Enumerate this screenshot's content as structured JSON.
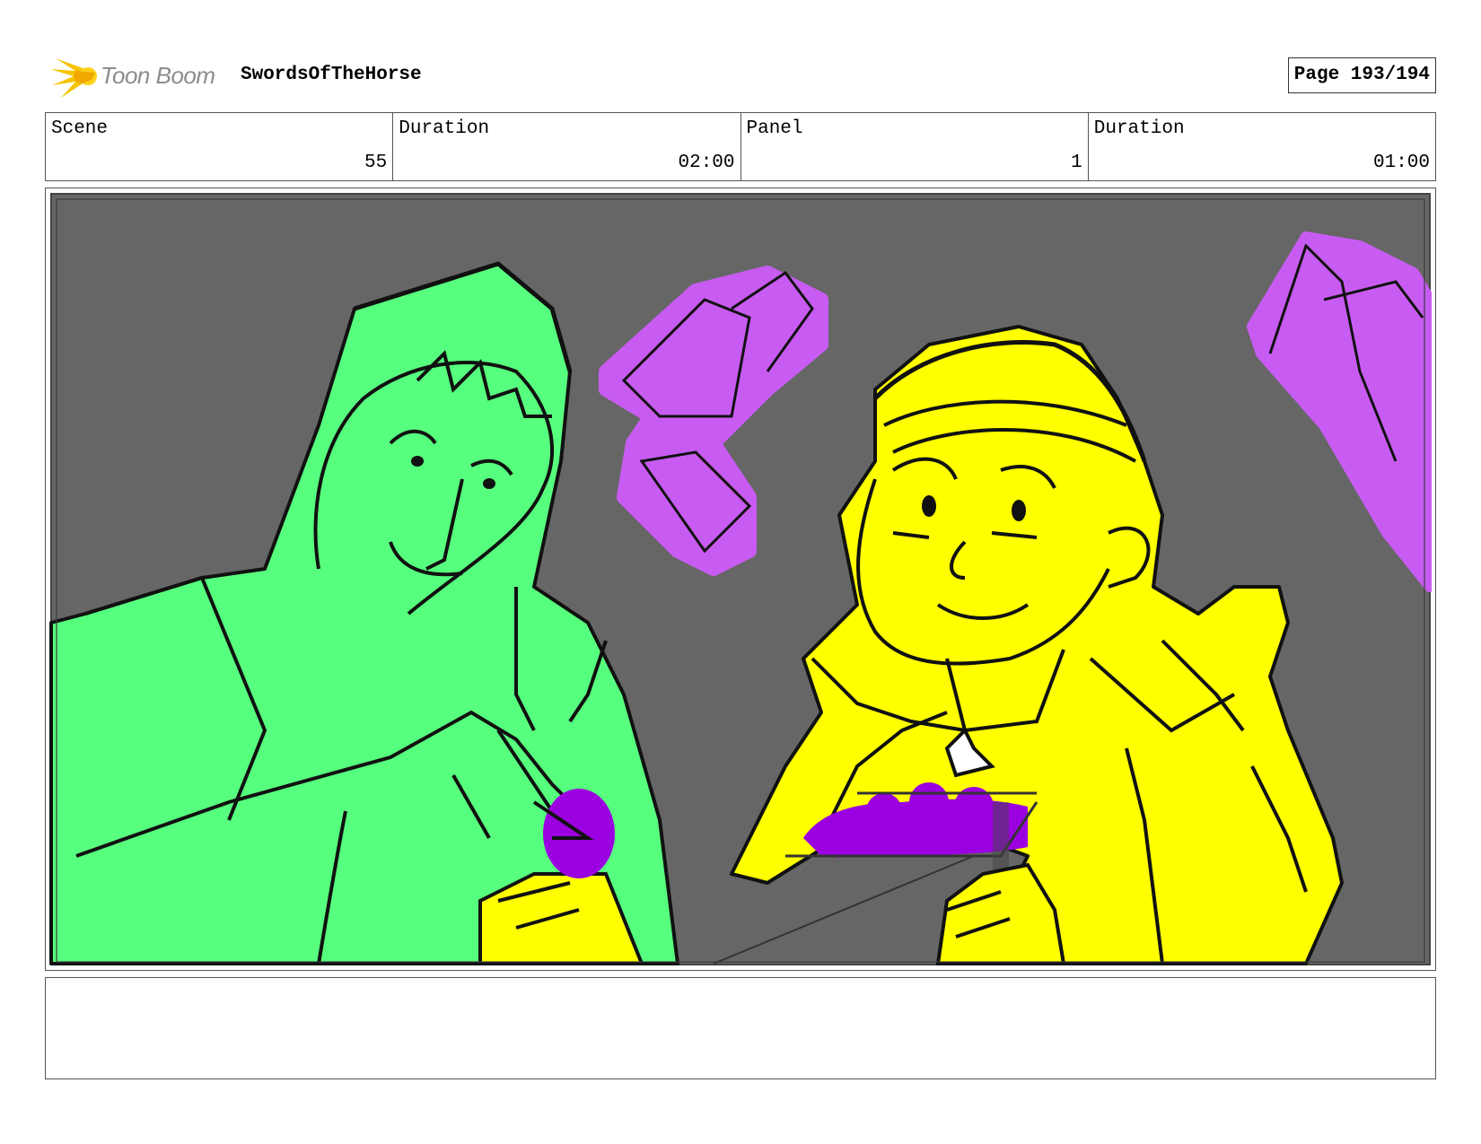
{
  "header": {
    "logo_text": "Toon Boom",
    "project_title": "SwordsOfTheHorse",
    "page_label": "Page 193/194"
  },
  "info": {
    "scene_label": "Scene",
    "scene_value": "55",
    "scene_duration_label": "Duration",
    "scene_duration_value": "02:00",
    "panel_label": "Panel",
    "panel_value": "1",
    "panel_duration_label": "Duration",
    "panel_duration_value": "01:00"
  },
  "colors": {
    "background": "#666666",
    "green_character": "#57ff7e",
    "yellow_character": "#ffff00",
    "gem_light": "#c85cf2",
    "gem_dark": "#9b00e0",
    "logo_accent": "#f5c400"
  },
  "notes": {
    "text": ""
  }
}
